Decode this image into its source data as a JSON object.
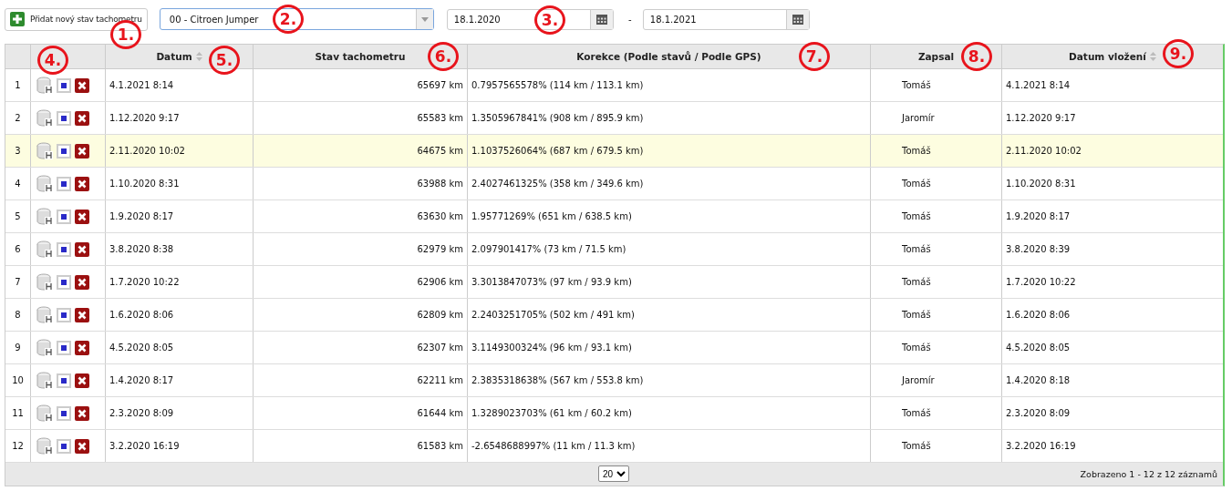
{
  "toolbar": {
    "add_button": "Přidat nový stav tachometru",
    "vehicle_select": "00 - Citroen Jumper",
    "date_from": "18.1.2020",
    "date_separator": "-",
    "date_to": "18.1.2021"
  },
  "table": {
    "columns": [
      "Datum",
      "Stav tachometru",
      "Korekce (Podle stavů / Podle GPS)",
      "Zapsal",
      "Datum vložení"
    ],
    "rows": [
      {
        "number": "1",
        "date": "4.1.2021 8:14",
        "odometer": "65697 km",
        "correction": "0.7957565578% (114 km / 113.1 km)",
        "author": "Tomáš",
        "inserted": "4.1.2021 8:14",
        "selected": false
      },
      {
        "number": "2",
        "date": "1.12.2020 9:17",
        "odometer": "65583 km",
        "correction": "1.3505967841% (908 km / 895.9 km)",
        "author": "Jaromír",
        "inserted": "1.12.2020 9:17",
        "selected": false
      },
      {
        "number": "3",
        "date": "2.11.2020 10:02",
        "odometer": "64675 km",
        "correction": "1.1037526064% (687 km / 679.5 km)",
        "author": "Tomáš",
        "inserted": "2.11.2020 10:02",
        "selected": true
      },
      {
        "number": "4",
        "date": "1.10.2020 8:31",
        "odometer": "63988 km",
        "correction": "2.4027461325% (358 km / 349.6 km)",
        "author": "Tomáš",
        "inserted": "1.10.2020 8:31",
        "selected": false
      },
      {
        "number": "5",
        "date": "1.9.2020 8:17",
        "odometer": "63630 km",
        "correction": "1.95771269% (651 km / 638.5 km)",
        "author": "Tomáš",
        "inserted": "1.9.2020 8:17",
        "selected": false
      },
      {
        "number": "6",
        "date": "3.8.2020 8:38",
        "odometer": "62979 km",
        "correction": "2.097901417% (73 km / 71.5 km)",
        "author": "Tomáš",
        "inserted": "3.8.2020 8:39",
        "selected": false
      },
      {
        "number": "7",
        "date": "1.7.2020 10:22",
        "odometer": "62906 km",
        "correction": "3.3013847073% (97 km / 93.9 km)",
        "author": "Tomáš",
        "inserted": "1.7.2020 10:22",
        "selected": false
      },
      {
        "number": "8",
        "date": "1.6.2020 8:06",
        "odometer": "62809 km",
        "correction": "2.2403251705% (502 km / 491 km)",
        "author": "Tomáš",
        "inserted": "1.6.2020 8:06",
        "selected": false
      },
      {
        "number": "9",
        "date": "4.5.2020 8:05",
        "odometer": "62307 km",
        "correction": "3.1149300324% (96 km / 93.1 km)",
        "author": "Tomáš",
        "inserted": "4.5.2020 8:05",
        "selected": false
      },
      {
        "number": "10",
        "date": "1.4.2020 8:17",
        "odometer": "62211 km",
        "correction": "2.3835318638% (567 km / 553.8 km)",
        "author": "Jaromír",
        "inserted": "1.4.2020 8:18",
        "selected": false
      },
      {
        "number": "11",
        "date": "2.3.2020 8:09",
        "odometer": "61644 km",
        "correction": "1.3289023703% (61 km / 60.2 km)",
        "author": "Tomáš",
        "inserted": "2.3.2020 8:09",
        "selected": false
      },
      {
        "number": "12",
        "date": "3.2.2020 16:19",
        "odometer": "61583 km",
        "correction": "-2.6548688997% (11 km / 11.3 km)",
        "author": "Tomáš",
        "inserted": "3.2.2020 16:19",
        "selected": false
      }
    ],
    "page_size": "20",
    "summary": "Zobrazeno 1 - 12 z 12 záznamů"
  },
  "annotations": [
    "1.",
    "2.",
    "3.",
    "4.",
    "5.",
    "6.",
    "7.",
    "8.",
    "9."
  ]
}
